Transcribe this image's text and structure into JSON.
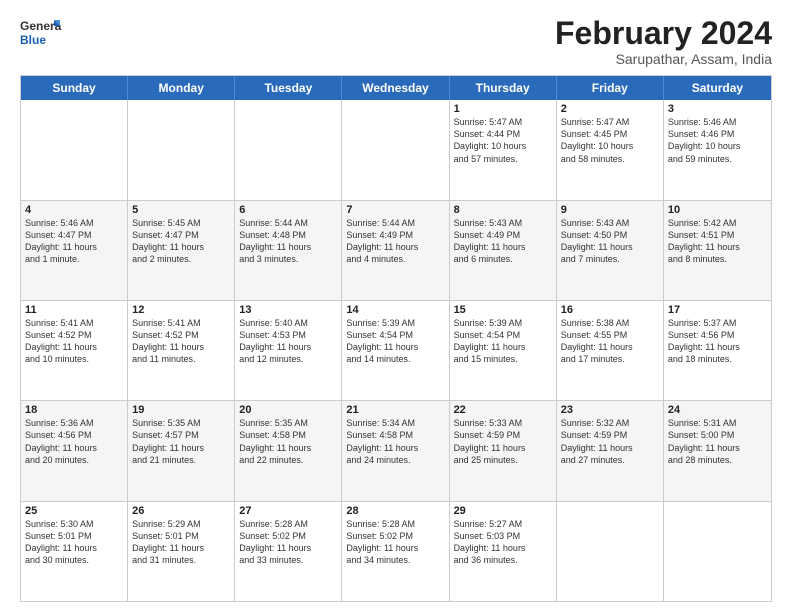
{
  "header": {
    "logo_line1": "General",
    "logo_line2": "Blue",
    "month": "February 2024",
    "location": "Sarupathar, Assam, India"
  },
  "days_of_week": [
    "Sunday",
    "Monday",
    "Tuesday",
    "Wednesday",
    "Thursday",
    "Friday",
    "Saturday"
  ],
  "rows": [
    {
      "alt": false,
      "cells": [
        {
          "num": "",
          "info": ""
        },
        {
          "num": "",
          "info": ""
        },
        {
          "num": "",
          "info": ""
        },
        {
          "num": "",
          "info": ""
        },
        {
          "num": "1",
          "info": "Sunrise: 5:47 AM\nSunset: 4:44 PM\nDaylight: 10 hours\nand 57 minutes."
        },
        {
          "num": "2",
          "info": "Sunrise: 5:47 AM\nSunset: 4:45 PM\nDaylight: 10 hours\nand 58 minutes."
        },
        {
          "num": "3",
          "info": "Sunrise: 5:46 AM\nSunset: 4:46 PM\nDaylight: 10 hours\nand 59 minutes."
        }
      ]
    },
    {
      "alt": true,
      "cells": [
        {
          "num": "4",
          "info": "Sunrise: 5:46 AM\nSunset: 4:47 PM\nDaylight: 11 hours\nand 1 minute."
        },
        {
          "num": "5",
          "info": "Sunrise: 5:45 AM\nSunset: 4:47 PM\nDaylight: 11 hours\nand 2 minutes."
        },
        {
          "num": "6",
          "info": "Sunrise: 5:44 AM\nSunset: 4:48 PM\nDaylight: 11 hours\nand 3 minutes."
        },
        {
          "num": "7",
          "info": "Sunrise: 5:44 AM\nSunset: 4:49 PM\nDaylight: 11 hours\nand 4 minutes."
        },
        {
          "num": "8",
          "info": "Sunrise: 5:43 AM\nSunset: 4:49 PM\nDaylight: 11 hours\nand 6 minutes."
        },
        {
          "num": "9",
          "info": "Sunrise: 5:43 AM\nSunset: 4:50 PM\nDaylight: 11 hours\nand 7 minutes."
        },
        {
          "num": "10",
          "info": "Sunrise: 5:42 AM\nSunset: 4:51 PM\nDaylight: 11 hours\nand 8 minutes."
        }
      ]
    },
    {
      "alt": false,
      "cells": [
        {
          "num": "11",
          "info": "Sunrise: 5:41 AM\nSunset: 4:52 PM\nDaylight: 11 hours\nand 10 minutes."
        },
        {
          "num": "12",
          "info": "Sunrise: 5:41 AM\nSunset: 4:52 PM\nDaylight: 11 hours\nand 11 minutes."
        },
        {
          "num": "13",
          "info": "Sunrise: 5:40 AM\nSunset: 4:53 PM\nDaylight: 11 hours\nand 12 minutes."
        },
        {
          "num": "14",
          "info": "Sunrise: 5:39 AM\nSunset: 4:54 PM\nDaylight: 11 hours\nand 14 minutes."
        },
        {
          "num": "15",
          "info": "Sunrise: 5:39 AM\nSunset: 4:54 PM\nDaylight: 11 hours\nand 15 minutes."
        },
        {
          "num": "16",
          "info": "Sunrise: 5:38 AM\nSunset: 4:55 PM\nDaylight: 11 hours\nand 17 minutes."
        },
        {
          "num": "17",
          "info": "Sunrise: 5:37 AM\nSunset: 4:56 PM\nDaylight: 11 hours\nand 18 minutes."
        }
      ]
    },
    {
      "alt": true,
      "cells": [
        {
          "num": "18",
          "info": "Sunrise: 5:36 AM\nSunset: 4:56 PM\nDaylight: 11 hours\nand 20 minutes."
        },
        {
          "num": "19",
          "info": "Sunrise: 5:35 AM\nSunset: 4:57 PM\nDaylight: 11 hours\nand 21 minutes."
        },
        {
          "num": "20",
          "info": "Sunrise: 5:35 AM\nSunset: 4:58 PM\nDaylight: 11 hours\nand 22 minutes."
        },
        {
          "num": "21",
          "info": "Sunrise: 5:34 AM\nSunset: 4:58 PM\nDaylight: 11 hours\nand 24 minutes."
        },
        {
          "num": "22",
          "info": "Sunrise: 5:33 AM\nSunset: 4:59 PM\nDaylight: 11 hours\nand 25 minutes."
        },
        {
          "num": "23",
          "info": "Sunrise: 5:32 AM\nSunset: 4:59 PM\nDaylight: 11 hours\nand 27 minutes."
        },
        {
          "num": "24",
          "info": "Sunrise: 5:31 AM\nSunset: 5:00 PM\nDaylight: 11 hours\nand 28 minutes."
        }
      ]
    },
    {
      "alt": false,
      "cells": [
        {
          "num": "25",
          "info": "Sunrise: 5:30 AM\nSunset: 5:01 PM\nDaylight: 11 hours\nand 30 minutes."
        },
        {
          "num": "26",
          "info": "Sunrise: 5:29 AM\nSunset: 5:01 PM\nDaylight: 11 hours\nand 31 minutes."
        },
        {
          "num": "27",
          "info": "Sunrise: 5:28 AM\nSunset: 5:02 PM\nDaylight: 11 hours\nand 33 minutes."
        },
        {
          "num": "28",
          "info": "Sunrise: 5:28 AM\nSunset: 5:02 PM\nDaylight: 11 hours\nand 34 minutes."
        },
        {
          "num": "29",
          "info": "Sunrise: 5:27 AM\nSunset: 5:03 PM\nDaylight: 11 hours\nand 36 minutes."
        },
        {
          "num": "",
          "info": ""
        },
        {
          "num": "",
          "info": ""
        }
      ]
    }
  ]
}
